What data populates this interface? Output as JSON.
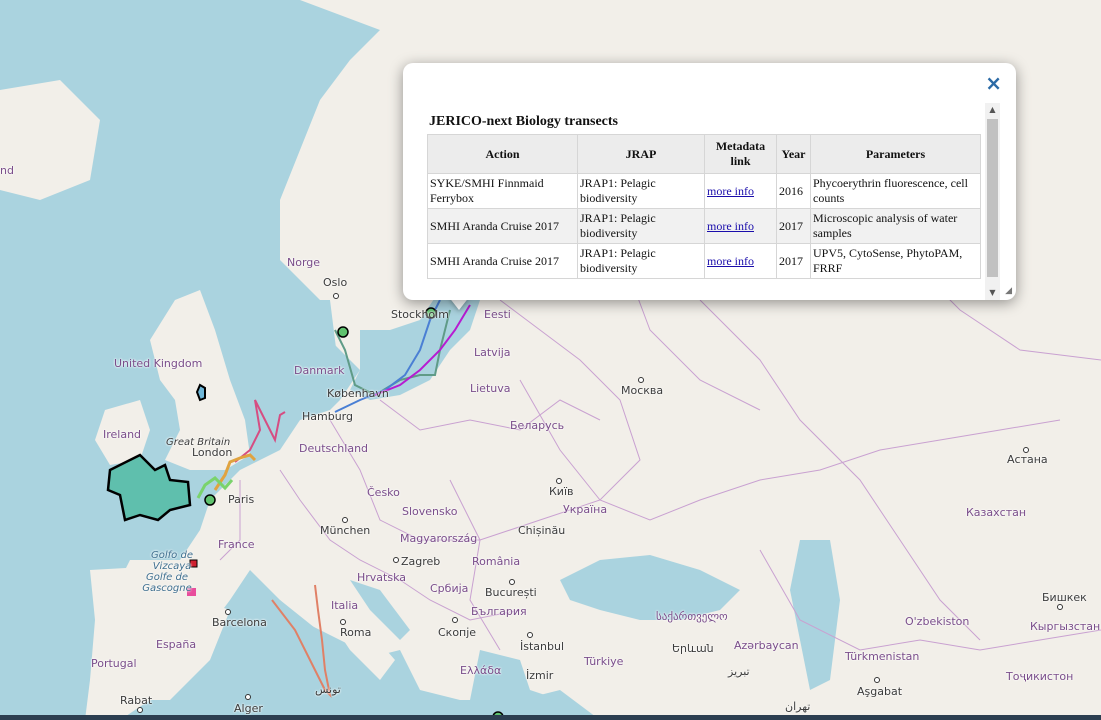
{
  "map": {
    "labels": [
      {
        "text": "Norge",
        "type": "country"
      },
      {
        "text": "Oslo",
        "type": "city"
      },
      {
        "text": "Stockholm",
        "type": "city"
      },
      {
        "text": "Eesti",
        "type": "country"
      },
      {
        "text": "Latvija",
        "type": "country"
      },
      {
        "text": "Lietuva",
        "type": "country"
      },
      {
        "text": "Danmark",
        "type": "country"
      },
      {
        "text": "København",
        "type": "city"
      },
      {
        "text": "Hamburg",
        "type": "city"
      },
      {
        "text": "United Kingdom",
        "type": "country"
      },
      {
        "text": "Great Britain",
        "type": "city"
      },
      {
        "text": "Ireland",
        "type": "country"
      },
      {
        "text": "London",
        "type": "city"
      },
      {
        "text": "Paris",
        "type": "city"
      },
      {
        "text": "Deutschland",
        "type": "country"
      },
      {
        "text": "Беларусь",
        "type": "country"
      },
      {
        "text": "Москва",
        "type": "city"
      },
      {
        "text": "Česko",
        "type": "country"
      },
      {
        "text": "Київ",
        "type": "city"
      },
      {
        "text": "Україна",
        "type": "country"
      },
      {
        "text": "Slovensko",
        "type": "country"
      },
      {
        "text": "München",
        "type": "city"
      },
      {
        "text": "Chișinău",
        "type": "city"
      },
      {
        "text": "France",
        "type": "country"
      },
      {
        "text": "Magyarország",
        "type": "country"
      },
      {
        "text": "Zagreb",
        "type": "city"
      },
      {
        "text": "România",
        "type": "country"
      },
      {
        "text": "Hrvatska",
        "type": "country"
      },
      {
        "text": "Golfo de Vizcaya",
        "type": "sea"
      },
      {
        "text": "Golfe de Gascogne",
        "type": "sea"
      },
      {
        "text": "Србија",
        "type": "country"
      },
      {
        "text": "București",
        "type": "city"
      },
      {
        "text": "Italia",
        "type": "country"
      },
      {
        "text": "България",
        "type": "country"
      },
      {
        "text": "საქართველო",
        "type": "country"
      },
      {
        "text": "Barcelona",
        "type": "city"
      },
      {
        "text": "Roma",
        "type": "city"
      },
      {
        "text": "Скопје",
        "type": "city"
      },
      {
        "text": "İstanbul",
        "type": "city"
      },
      {
        "text": "Երևան",
        "type": "city"
      },
      {
        "text": "Azərbaycan",
        "type": "country"
      },
      {
        "text": "España",
        "type": "country"
      },
      {
        "text": "Portugal",
        "type": "country"
      },
      {
        "text": "Ελλάδα",
        "type": "country"
      },
      {
        "text": "İzmir",
        "type": "city"
      },
      {
        "text": "Türkiye",
        "type": "country"
      },
      {
        "text": "تبریز",
        "type": "city"
      },
      {
        "text": "Rabat",
        "type": "city"
      },
      {
        "text": "Alger",
        "type": "city"
      },
      {
        "text": "تونس",
        "type": "city"
      },
      {
        "text": "تهران",
        "type": "city"
      },
      {
        "text": "Астана",
        "type": "city"
      },
      {
        "text": "Казахстан",
        "type": "country"
      },
      {
        "text": "Бишкек",
        "type": "city"
      },
      {
        "text": "O'zbekiston",
        "type": "country"
      },
      {
        "text": "Кыргызстан",
        "type": "country"
      },
      {
        "text": "Türkmenistan",
        "type": "country"
      },
      {
        "text": "Тоҷикистон",
        "type": "country"
      },
      {
        "text": "Aşgabat",
        "type": "city"
      },
      {
        "text": "nd",
        "type": "country"
      }
    ],
    "colors": {
      "water": "#aad3df",
      "land": "#f2efe9",
      "border": "#c9a1d1",
      "transect_blue": "#4a7fd4",
      "transect_purple": "#b71bd1",
      "transect_teal": "#5f9b87",
      "area_fill": "#5fbfad"
    }
  },
  "popup": {
    "close_label": "×",
    "title": "JERICO-next Biology transects",
    "columns": [
      "Action",
      "JRAP",
      "Metadata link",
      "Year",
      "Parameters"
    ],
    "rows": [
      {
        "action": "SYKE/SMHI Finnmaid Ferrybox",
        "jrap": "JRAP1: Pelagic biodiversity",
        "link": "more info",
        "year": "2016",
        "parameters": "Phycoerythrin fluorescence, cell counts"
      },
      {
        "action": "SMHI Aranda Cruise 2017",
        "jrap": "JRAP1: Pelagic biodiversity",
        "link": "more info",
        "year": "2017",
        "parameters": "Microscopic analysis of water samples"
      },
      {
        "action": "SMHI Aranda Cruise 2017",
        "jrap": "JRAP1: Pelagic biodiversity",
        "link": "more info",
        "year": "2017",
        "parameters": "UPV5, CytoSense, PhytoPAM, FRRF"
      }
    ]
  }
}
